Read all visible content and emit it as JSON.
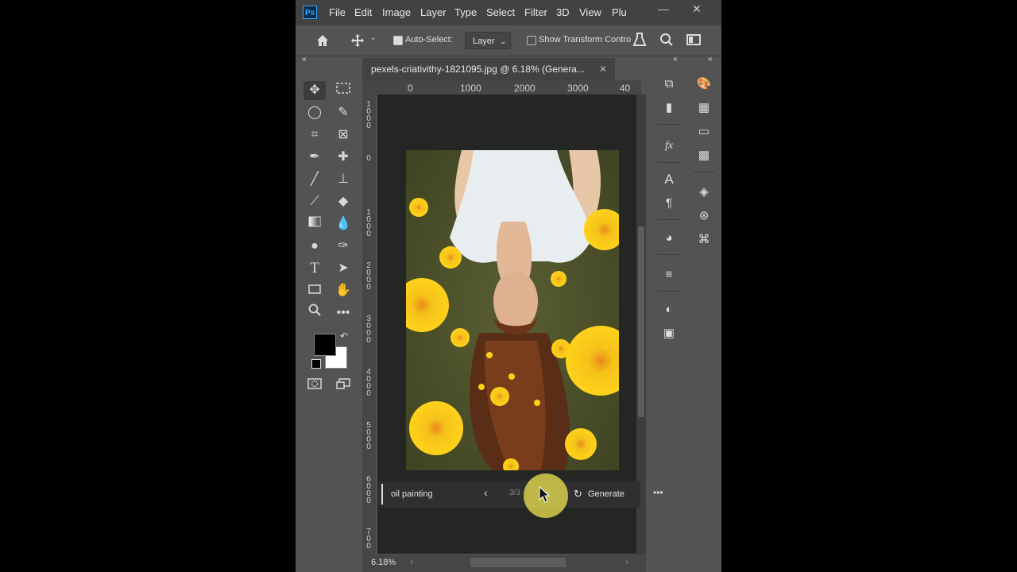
{
  "app": {
    "logo": "Ps"
  },
  "menu": [
    "File",
    "Edit",
    "Image",
    "Layer",
    "Type",
    "Select",
    "Filter",
    "3D",
    "View",
    "Plu"
  ],
  "window_controls": {
    "minimize": "—",
    "maximize": "☐",
    "close": "✕"
  },
  "options_bar": {
    "auto_select_label": "Auto-Select:",
    "auto_select_target": "Layer",
    "show_transform_label": "Show Transform Contro"
  },
  "document": {
    "tab_title": "pexels-criativithy-1821095.jpg @ 6.18% (Genera...",
    "close": "✕",
    "ruler_h": [
      "0",
      "1000",
      "2000",
      "3000",
      "40"
    ],
    "ruler_v": [
      {
        "digits": [
          "1",
          "0",
          "0",
          "0"
        ]
      },
      {
        "digits": [
          "0"
        ]
      },
      {
        "digits": [
          "1",
          "0",
          "0",
          "0"
        ]
      },
      {
        "digits": [
          "2",
          "0",
          "0",
          "0"
        ]
      },
      {
        "digits": [
          "3",
          "0",
          "0",
          "0"
        ]
      },
      {
        "digits": [
          "4",
          "0",
          "0",
          "0"
        ]
      },
      {
        "digits": [
          "5",
          "0",
          "0",
          "0"
        ]
      },
      {
        "digits": [
          "6",
          "0",
          "0",
          "0"
        ]
      },
      {
        "digits": [
          "7",
          "0",
          "0"
        ]
      }
    ]
  },
  "contextual_bar": {
    "prompt": "oil painting",
    "variation_counter": "3/3",
    "generate_label": "Generate",
    "more": "•••"
  },
  "status": {
    "zoom": "6.18%"
  },
  "colors": {
    "foreground": "#000000",
    "background": "#ffffff",
    "accent_ring": "#f0e650"
  }
}
